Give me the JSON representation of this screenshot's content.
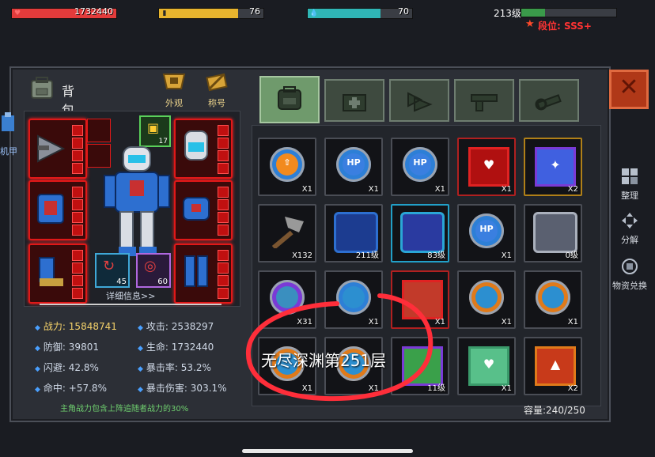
{
  "hud": {
    "hp": {
      "value": "1732440",
      "fraction": 1.0,
      "color": "#e33b3b",
      "icon": "heart-icon"
    },
    "energy": {
      "value": "76",
      "fraction": 0.76,
      "color": "#e8b52e",
      "icon": "battery-icon"
    },
    "water": {
      "value": "70",
      "fraction": 0.7,
      "color": "#2fb6b6",
      "icon": "water-drop-icon"
    },
    "level": {
      "label": "213级",
      "fraction": 0.25,
      "color": "#3a9a4a"
    },
    "rank": {
      "label": "段位: SSS+",
      "icon": "star-icon",
      "color": "#ff3333"
    }
  },
  "inventory": {
    "title": "背包",
    "appearance_label": "外观",
    "title_label": "称号",
    "side_tab_label": "机甲",
    "badge_level": "17",
    "orb_a_value": "45",
    "orb_b_value": "60",
    "detail_link": "详细信息>>",
    "stats": {
      "power_label": "战力:",
      "power_value": "15848741",
      "attack_label": "攻击:",
      "attack_value": "2538297",
      "defense_label": "防御:",
      "defense_value": "39801",
      "life_label": "生命:",
      "life_value": "1732440",
      "dodge_label": "闪避:",
      "dodge_value": "42.8%",
      "crit_label": "暴击率:",
      "crit_value": "53.2%",
      "hit_label": "命中:",
      "hit_value": "+57.8%",
      "critdmg_label": "暴击伤害:",
      "critdmg_value": "303.1%"
    },
    "note": "主角战力包含上阵追随者战力的30%",
    "capacity": "容量:240/250"
  },
  "tabs": [
    {
      "name": "backpack",
      "icon": "backpack-icon"
    },
    {
      "name": "medkit",
      "icon": "medkit-icon"
    },
    {
      "name": "claw",
      "icon": "claw-icon"
    },
    {
      "name": "gun",
      "icon": "gun-icon"
    },
    {
      "name": "wrench",
      "icon": "wrench-icon"
    }
  ],
  "grid": {
    "cells": [
      {
        "icon": "boost-orb-icon",
        "qty": "X1",
        "type": "orb",
        "label": "⇧",
        "ring": "#2d7fd6",
        "core": "#f28a1e",
        "border": "#4a4d55"
      },
      {
        "icon": "hp-orb-icon",
        "qty": "X1",
        "type": "orb",
        "label": "HP",
        "ring": "#2d7fd6",
        "core": "#3a7fe0",
        "border": "#4a4d55"
      },
      {
        "icon": "hp-orb-icon",
        "qty": "X1",
        "type": "orb",
        "label": "HP",
        "ring": "#2d7fd6",
        "core": "#3a7fe0",
        "border": "#4a4d55"
      },
      {
        "icon": "heart-card-icon",
        "qty": "X1",
        "type": "card",
        "label": "♥",
        "ring": "#e02222",
        "core": "#b01010",
        "border": "#b02020"
      },
      {
        "icon": "shield-device-icon",
        "qty": "X2",
        "type": "card",
        "label": "✦",
        "ring": "#7a3ad6",
        "core": "#4060e0",
        "border": "#b08018"
      },
      {
        "icon": "hammer-icon",
        "qty": "X132",
        "type": "tool",
        "label": "",
        "ring": "#999",
        "core": "#7a5530",
        "border": "#4a4d55"
      },
      {
        "icon": "armor-icon",
        "qty": "211级",
        "type": "armor",
        "label": "",
        "ring": "#2d6fd0",
        "core": "#1c3c90",
        "border": "#4a4d55"
      },
      {
        "icon": "gauntlet-icon",
        "qty": "83级",
        "type": "armor",
        "label": "",
        "ring": "#2aa6d6",
        "core": "#2a3aa0",
        "border": "#22a0c8"
      },
      {
        "icon": "hp-orb-icon",
        "qty": "X1",
        "type": "orb",
        "label": "HP",
        "ring": "#2d7fd6",
        "core": "#3a7fe0",
        "border": "#4a4d55"
      },
      {
        "icon": "mech-part-icon",
        "qty": "0级",
        "type": "armor",
        "label": "",
        "ring": "#aab0bc",
        "core": "#5a6070",
        "border": "#4a4d55"
      },
      {
        "icon": "gear-orb-icon",
        "qty": "X31",
        "type": "orb",
        "label": "",
        "ring": "#7a3ad6",
        "core": "#3a8fbf",
        "border": "#4a4d55"
      },
      {
        "icon": "drive-orb-icon",
        "qty": "X1",
        "type": "orb",
        "label": "",
        "ring": "#2d7fd6",
        "core": "#2c8fd0",
        "border": "#4a4d55"
      },
      {
        "icon": "box-icon",
        "qty": "X1",
        "type": "card",
        "label": "",
        "ring": "#e02222",
        "core": "#c23a2a",
        "border": "#b02020"
      },
      {
        "icon": "drive-orb-icon",
        "qty": "X1",
        "type": "orb",
        "label": "",
        "ring": "#e07a1a",
        "core": "#2c8fd0",
        "border": "#4a4d55"
      },
      {
        "icon": "drive-orb-icon",
        "qty": "X1",
        "type": "orb",
        "label": "",
        "ring": "#e07a1a",
        "core": "#2c8fd0",
        "border": "#4a4d55"
      },
      {
        "icon": "drive-orb-icon",
        "qty": "X1",
        "type": "orb",
        "label": "",
        "ring": "#e07a1a",
        "core": "#2c8fd0",
        "border": "#4a4d55"
      },
      {
        "icon": "drive-orb-icon",
        "qty": "X1",
        "type": "orb",
        "label": "",
        "ring": "#e07a1a",
        "core": "#2c8fd0",
        "border": "#4a4d55"
      },
      {
        "icon": "canister-icon",
        "qty": "11级",
        "type": "card",
        "label": "",
        "ring": "#7a3ad6",
        "core": "#3aa04a",
        "border": "#4a4d55"
      },
      {
        "icon": "medical-device-icon",
        "qty": "X1",
        "type": "card",
        "label": "♥",
        "ring": "#3a9a6a",
        "core": "#58c08a",
        "border": "#4a4d55"
      },
      {
        "icon": "monitor-icon",
        "qty": "X2",
        "type": "card",
        "label": "▲",
        "ring": "#e07a1a",
        "core": "#c83a1a",
        "border": "#4a4d55"
      }
    ]
  },
  "side_actions": {
    "sort_label": "整理",
    "decompose_label": "分解",
    "exchange_label": "物资兑换"
  },
  "annotation": {
    "text": "无尽深渊第251层",
    "color": "#ff2e3a"
  }
}
